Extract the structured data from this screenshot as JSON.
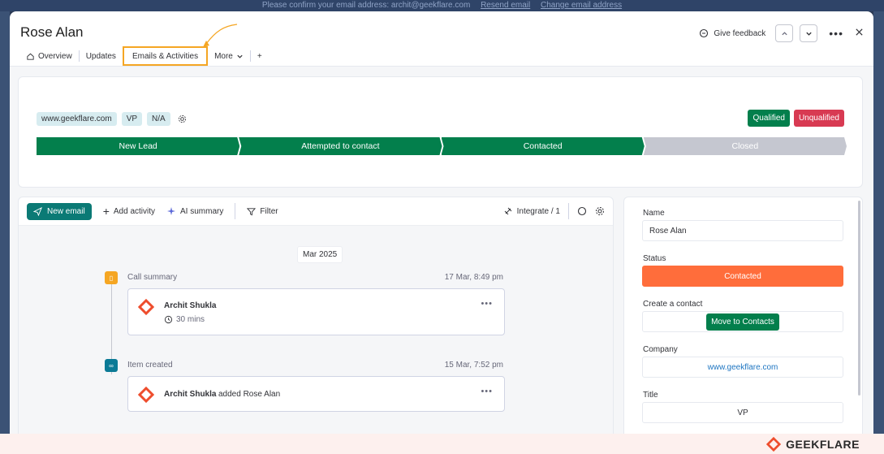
{
  "banner": {
    "message": "Please confirm your email address: archit@geekflare.com",
    "resend": "Resend email",
    "change": "Change email address"
  },
  "header": {
    "title": "Rose Alan",
    "feedback": "Give feedback",
    "tabs": [
      "Overview",
      "Updates",
      "Emails & Activities",
      "More",
      "+"
    ]
  },
  "lead": {
    "chips": [
      "www.geekflare.com",
      "VP",
      "N/A"
    ],
    "qualified": "Qualified",
    "unqualified": "Unqualified",
    "stages": [
      {
        "label": "New Lead",
        "color": "#037f4c"
      },
      {
        "label": "Attempted to contact",
        "color": "#037f4c"
      },
      {
        "label": "Contacted",
        "color": "#037f4c"
      },
      {
        "label": "Closed",
        "color": "#c5c7d0"
      }
    ],
    "colors": {
      "qualified": "#037f4c",
      "unqualified": "#d83a52"
    }
  },
  "toolbar": {
    "new_email": "New email",
    "add_activity": "Add activity",
    "ai_summary": "AI summary",
    "filter": "Filter",
    "integrate": "Integrate / 1"
  },
  "feed": {
    "date": "Mar 2025",
    "events": [
      {
        "type": "Call summary",
        "time": "17 Mar, 8:49 pm",
        "name": "Archit Shukla",
        "detail": "30 mins",
        "icon_color": "#f5a623"
      },
      {
        "type": "Item created",
        "time": "15 Mar, 7:52 pm",
        "name": "Archit Shukla",
        "detail": "added Rose Alan",
        "icon_color": "#0b7a96"
      }
    ]
  },
  "side": {
    "name_label": "Name",
    "name_value": "Rose Alan",
    "status_label": "Status",
    "status_value": "Contacted",
    "status_color": "#ff6d3b",
    "contact_label": "Create a contact",
    "contact_button": "Move to Contacts",
    "company_label": "Company",
    "company_value": "www.geekflare.com",
    "title_label": "Title",
    "title_value": "VP"
  },
  "brand": "GEEKFLARE"
}
